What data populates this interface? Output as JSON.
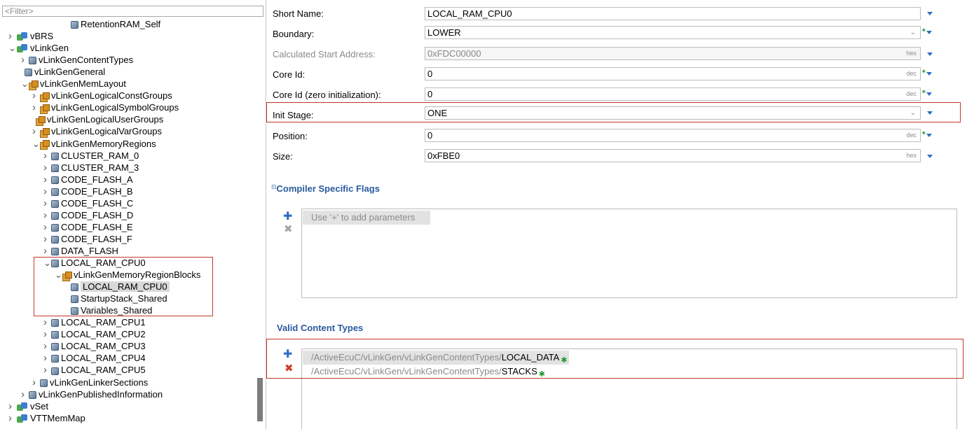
{
  "tree": {
    "filter_placeholder": "<Filter>",
    "items": [
      {
        "label": "RetentionRAM_Self",
        "level": 5,
        "icon": "param",
        "arrow": ""
      },
      {
        "label": "vBRS",
        "level": 0,
        "icon": "module",
        "arrow": ">"
      },
      {
        "label": "vLinkGen",
        "level": 0,
        "icon": "module",
        "arrow": "v"
      },
      {
        "label": "vLinkGenContentTypes",
        "level": 1,
        "icon": "param",
        "arrow": ">"
      },
      {
        "label": "vLinkGenGeneral",
        "level": 1,
        "icon": "param",
        "arrow": ""
      },
      {
        "label": "vLinkGenMemLayout",
        "level": 1,
        "icon": "container",
        "arrow": "v"
      },
      {
        "label": "vLinkGenLogicalConstGroups",
        "level": 2,
        "icon": "container",
        "arrow": ">"
      },
      {
        "label": "vLinkGenLogicalSymbolGroups",
        "level": 2,
        "icon": "container",
        "arrow": ">"
      },
      {
        "label": "vLinkGenLogicalUserGroups",
        "level": 2,
        "icon": "container",
        "arrow": ""
      },
      {
        "label": "vLinkGenLogicalVarGroups",
        "level": 2,
        "icon": "container",
        "arrow": ">"
      },
      {
        "label": "vLinkGenMemoryRegions",
        "level": 2,
        "icon": "container",
        "arrow": "v"
      },
      {
        "label": "CLUSTER_RAM_0",
        "level": 3,
        "icon": "param",
        "arrow": ">"
      },
      {
        "label": "CLUSTER_RAM_3",
        "level": 3,
        "icon": "param",
        "arrow": ">"
      },
      {
        "label": "CODE_FLASH_A",
        "level": 3,
        "icon": "param",
        "arrow": ">"
      },
      {
        "label": "CODE_FLASH_B",
        "level": 3,
        "icon": "param",
        "arrow": ">"
      },
      {
        "label": "CODE_FLASH_C",
        "level": 3,
        "icon": "param",
        "arrow": ">"
      },
      {
        "label": "CODE_FLASH_D",
        "level": 3,
        "icon": "param",
        "arrow": ">"
      },
      {
        "label": "CODE_FLASH_E",
        "level": 3,
        "icon": "param",
        "arrow": ">"
      },
      {
        "label": "CODE_FLASH_F",
        "level": 3,
        "icon": "param",
        "arrow": ">"
      },
      {
        "label": "DATA_FLASH",
        "level": 3,
        "icon": "param",
        "arrow": ">"
      },
      {
        "label": "LOCAL_RAM_CPU0",
        "level": 3,
        "icon": "param",
        "arrow": "v"
      },
      {
        "label": "vLinkGenMemoryRegionBlocks",
        "level": 4,
        "icon": "container",
        "arrow": "v"
      },
      {
        "label": "LOCAL_RAM_CPU0",
        "level": 5,
        "icon": "param",
        "arrow": "",
        "selected": true
      },
      {
        "label": "StartupStack_Shared",
        "level": 5,
        "icon": "param",
        "arrow": ""
      },
      {
        "label": "Variables_Shared",
        "level": 5,
        "icon": "param",
        "arrow": ""
      },
      {
        "label": "LOCAL_RAM_CPU1",
        "level": 3,
        "icon": "param",
        "arrow": ">"
      },
      {
        "label": "LOCAL_RAM_CPU2",
        "level": 3,
        "icon": "param",
        "arrow": ">"
      },
      {
        "label": "LOCAL_RAM_CPU3",
        "level": 3,
        "icon": "param",
        "arrow": ">"
      },
      {
        "label": "LOCAL_RAM_CPU4",
        "level": 3,
        "icon": "param",
        "arrow": ">"
      },
      {
        "label": "LOCAL_RAM_CPU5",
        "level": 3,
        "icon": "param",
        "arrow": ">"
      },
      {
        "label": "vLinkGenLinkerSections",
        "level": 2,
        "icon": "param",
        "arrow": ">"
      },
      {
        "label": "vLinkGenPublishedInformation",
        "level": 1,
        "icon": "param",
        "arrow": ">"
      },
      {
        "label": "vSet",
        "level": 0,
        "icon": "module",
        "arrow": ">"
      },
      {
        "label": "VTTMemMap",
        "level": 0,
        "icon": "module",
        "arrow": ">"
      }
    ]
  },
  "form": {
    "short_name": {
      "label": "Short Name:",
      "value": "LOCAL_RAM_CPU0"
    },
    "boundary": {
      "label": "Boundary:",
      "value": "LOWER"
    },
    "calc_start": {
      "label": "Calculated Start Address:",
      "value": "0xFDC00000",
      "suffix": "hex"
    },
    "core_id": {
      "label": "Core Id:",
      "value": "0",
      "suffix": "dec"
    },
    "core_id_zero": {
      "label": "Core Id (zero initialization):",
      "value": "0",
      "suffix": "dec"
    },
    "init_stage": {
      "label": "Init Stage:",
      "value": "ONE"
    },
    "position": {
      "label": "Position:",
      "value": "0",
      "suffix": "dec"
    },
    "size": {
      "label": "Size:",
      "value": "0xFBE0",
      "suffix": "hex"
    }
  },
  "compiler_flags": {
    "title": "Compiler Specific Flags",
    "placeholder": "Use '+' to add parameters"
  },
  "valid_content_types": {
    "title": "Valid Content Types",
    "items": [
      {
        "prefix": "/ActiveEcuC/vLinkGen/vLinkGenContentTypes/",
        "ref": "LOCAL_DATA"
      },
      {
        "prefix": "/ActiveEcuC/vLinkGen/vLinkGenContentTypes/",
        "ref": "STACKS"
      }
    ]
  },
  "colors": {
    "accent": "#2f6fbf",
    "highlight_box": "#c0392b",
    "required_mark": "#1e9c2e",
    "selection": "#d9d9d9"
  }
}
